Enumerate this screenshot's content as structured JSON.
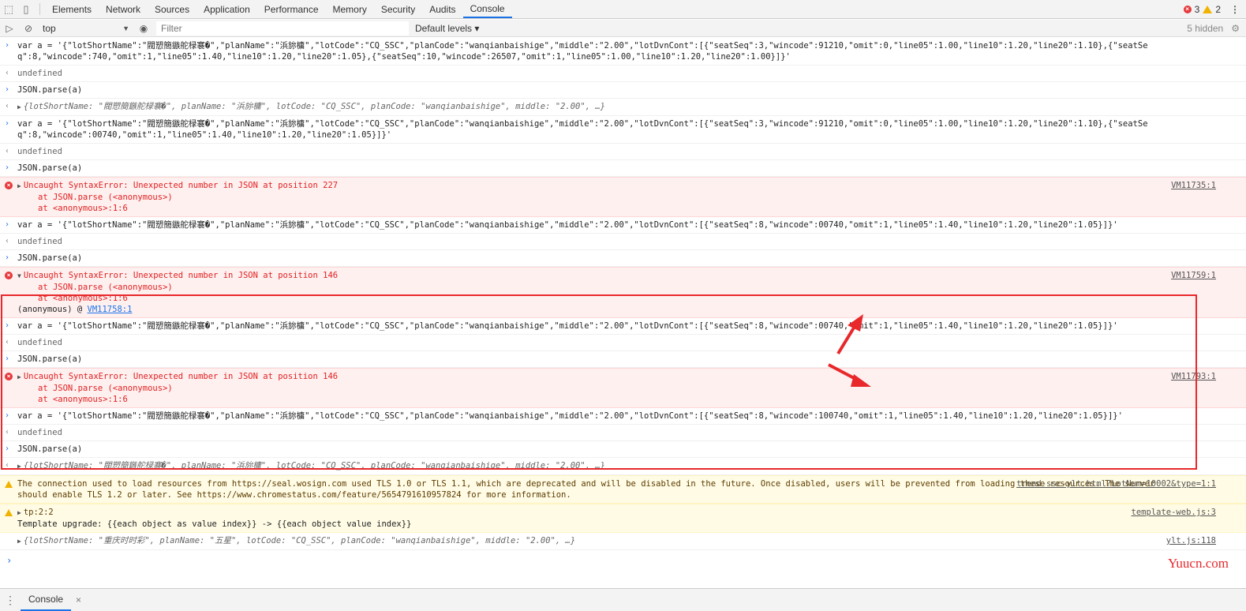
{
  "tabs": [
    "Elements",
    "Network",
    "Sources",
    "Application",
    "Performance",
    "Memory",
    "Security",
    "Audits",
    "Console"
  ],
  "active_tab": "Console",
  "counts": {
    "errors": "3",
    "warnings": "2"
  },
  "toolbar": {
    "context": "top",
    "filter_placeholder": "Filter",
    "levels": "Default levels ▾",
    "hidden": "5 hidden"
  },
  "log": {
    "r1": "var a = '{\"lotShortName\":\"閥愬簡鏃舵椂褰�\",\"planName\":\"浜旀槦\",\"lotCode\":\"CQ_SSC\",\"planCode\":\"wanqianbaishige\",\"middle\":\"2.00\",\"lotDvnCont\":[{\"seatSeq\":3,\"wincode\":91210,\"omit\":0,\"line05\":1.00,\"line10\":1.20,\"line20\":1.10},{\"seatSeq\":8,\"wincode\":740,\"omit\":1,\"line05\":1.40,\"line10\":1.20,\"line20\":1.05},{\"seatSeq\":10,\"wincode\":26507,\"omit\":1,\"line05\":1.00,\"line10\":1.20,\"line20\":1.00}]}'",
    "r2": "undefined",
    "r3": "JSON.parse(a)",
    "r4": "{lotShortName: \"閥愬簡鏃舵椂褰�\", planName: \"浜旀槦\", lotCode: \"CQ_SSC\", planCode: \"wanqianbaishige\", middle: \"2.00\", …}",
    "r5": "var a = '{\"lotShortName\":\"閥愬簡鏃舵椂褰�\",\"planName\":\"浜旀槦\",\"lotCode\":\"CQ_SSC\",\"planCode\":\"wanqianbaishige\",\"middle\":\"2.00\",\"lotDvnCont\":[{\"seatSeq\":3,\"wincode\":91210,\"omit\":0,\"line05\":1.00,\"line10\":1.20,\"line20\":1.10},{\"seatSeq\":8,\"wincode\":00740,\"omit\":1,\"line05\":1.40,\"line10\":1.20,\"line20\":1.05}]}'",
    "r6": "undefined",
    "r7": "JSON.parse(a)",
    "r8": "Uncaught SyntaxError: Unexpected number in JSON at position 227",
    "r8_s1": "at JSON.parse (<anonymous>)",
    "r8_s2": "at <anonymous>:1:6",
    "r8_src": "VM11735:1",
    "r9": "var a = '{\"lotShortName\":\"閥愬簡鏃舵椂褰�\",\"planName\":\"浜旀槦\",\"lotCode\":\"CQ_SSC\",\"planCode\":\"wanqianbaishige\",\"middle\":\"2.00\",\"lotDvnCont\":[{\"seatSeq\":8,\"wincode\":00740,\"omit\":1,\"line05\":1.40,\"line10\":1.20,\"line20\":1.05}]}'",
    "r10": "undefined",
    "r11": "JSON.parse(a)",
    "r12": "Uncaught SyntaxError: Unexpected number in JSON at position 146",
    "r12_s1": "at JSON.parse (<anonymous>)",
    "r12_s2": "at <anonymous>:1:6",
    "r12_anon": "(anonymous) @",
    "r12_anon_link": "VM11758:1",
    "r12_src": "VM11759:1",
    "r13": "var a = '{\"lotShortName\":\"閥愬簡鏃舵椂褰�\",\"planName\":\"浜旀槦\",\"lotCode\":\"CQ_SSC\",\"planCode\":\"wanqianbaishige\",\"middle\":\"2.00\",\"lotDvnCont\":[{\"seatSeq\":8,\"wincode\":00740,\"omit\":1,\"line05\":1.40,\"line10\":1.20,\"line20\":1.05}]}'",
    "r14": "undefined",
    "r15": "JSON.parse(a)",
    "r16": "Uncaught SyntaxError: Unexpected number in JSON at position 146",
    "r16_s1": "at JSON.parse (<anonymous>)",
    "r16_s2": "at <anonymous>:1:6",
    "r16_src": "VM11793:1",
    "r17": "var a = '{\"lotShortName\":\"閥愬簡鏃舵椂褰�\",\"planName\":\"浜旀槦\",\"lotCode\":\"CQ_SSC\",\"planCode\":\"wanqianbaishige\",\"middle\":\"2.00\",\"lotDvnCont\":[{\"seatSeq\":8,\"wincode\":100740,\"omit\":1,\"line05\":1.40,\"line10\":1.20,\"line20\":1.05}]}'",
    "r18": "undefined",
    "r19": "JSON.parse(a)",
    "r20": "{lotShortName: \"閥愬簡鏃舵椂褰�\", planName: \"浜旀槦\", lotCode: \"CQ_SSC\", planCode: \"wanqianbaishige\", middle: \"2.00\", …}",
    "w1": "The connection used to load resources from https://seal.wosign.com used TLS 1.0 or TLS 1.1, which are deprecated and will be disabled in the future. Once disabled, users will be prevented from loading these resources. The server should enable TLS 1.2 or later. See https://www.chromestatus.com/feature/5654791610957824 for more information.",
    "w1_src": "trend-ssc-ylt.html?LotNum=10002&type=1:1",
    "w2a": "tp:2:2",
    "w2b": "Template upgrade: {{each object as value index}} -> {{each object value index}}",
    "w2_src": "template-web.js:3",
    "r21": "{lotShortName: \"重庆时时彩\", planName: \"五星\", lotCode: \"CQ_SSC\", planCode: \"wanqianbaishige\", middle: \"2.00\", …}",
    "r21_src": "ylt.js:118"
  },
  "watermark": "Yuucn.com",
  "drawer_tab": "Console"
}
